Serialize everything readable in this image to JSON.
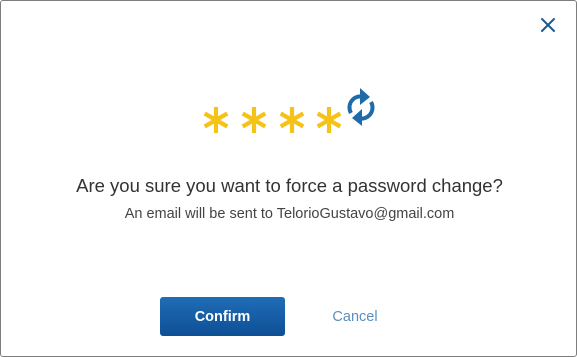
{
  "dialog": {
    "title": "Are you sure you want to force a password change?",
    "message": "An email will be sent to TelorioGustavo@gmail.com",
    "confirm_label": "Confirm",
    "cancel_label": "Cancel",
    "close_icon": "close-icon",
    "illustration": {
      "masked_characters": 4,
      "icon": "refresh-icon"
    }
  },
  "colors": {
    "asterisk": "#f5c217",
    "refresh": "#1f6aa8",
    "primary_button": "#155ea7",
    "link": "#5b8fbf",
    "close": "#1e5a91"
  }
}
